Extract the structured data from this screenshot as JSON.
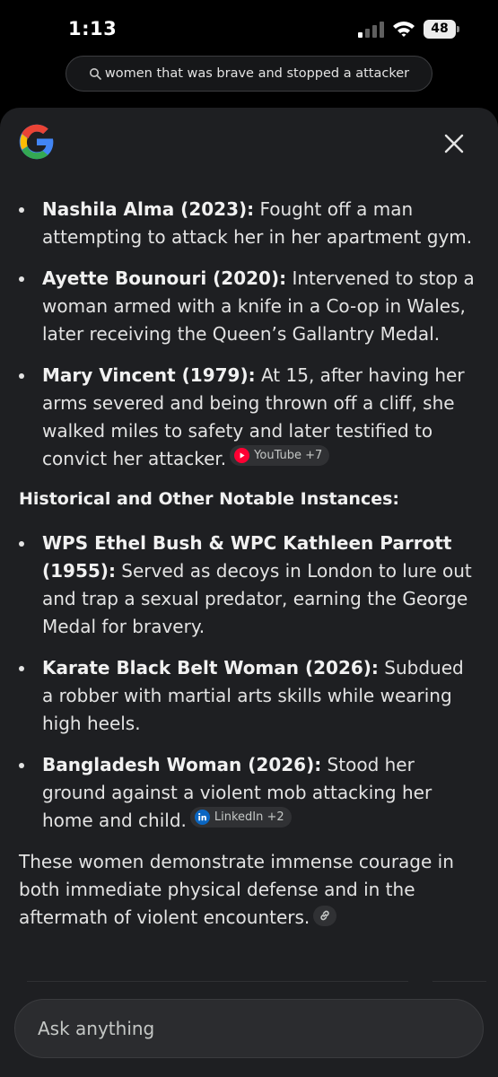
{
  "status_bar": {
    "time": "1:13",
    "battery": "48"
  },
  "search": {
    "query": "women that was brave and stopped a attacker"
  },
  "header": {
    "logo_icon": "google-g-icon",
    "close_icon": "close-icon"
  },
  "list_a": [
    {
      "name": "Nashila Alma (2023):",
      "desc": " Fought off a man attempting to attack her in her apartment gym."
    },
    {
      "name": "Ayette Bounouri (2020):",
      "desc": " Intervened to stop a woman armed with a knife in a Co-op in Wales, later receiving the Queen’s Gallantry Medal."
    },
    {
      "name": "Mary Vincent (1979):",
      "desc": " At 15, after having her arms severed and being thrown off a cliff, she walked miles to safety and later testified to convict her attacker.",
      "chip": "YouTube +7"
    }
  ],
  "section_heading": "Historical and Other Notable Instances:",
  "list_b": [
    {
      "name": "WPS Ethel Bush & WPC Kathleen Parrott (1955):",
      "desc": " Served as decoys in London to lure out and trap a sexual predator, earning the George Medal for bravery."
    },
    {
      "name": "Karate Black Belt Woman (2026):",
      "desc": " Subdued a robber with martial arts skills while wearing high heels."
    },
    {
      "name": "Bangladesh Woman (2026):",
      "desc": " Stood her ground against a violent mob attacking her home and child.",
      "chip": "LinkedIn +2"
    }
  ],
  "summary": "These women demonstrate immense courage in both immediate physical defense and in the aftermath of violent encounters.",
  "ask": {
    "placeholder": "Ask anything"
  },
  "colors": {
    "background": "#000000",
    "panel": "#1e1f22",
    "youtube_red": "#ff0000",
    "linkedin_blue": "#0a66c2"
  }
}
